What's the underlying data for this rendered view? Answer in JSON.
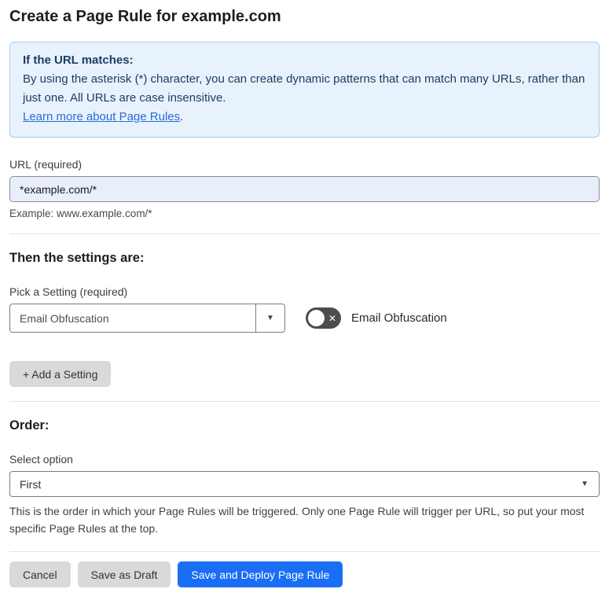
{
  "page": {
    "title": "Create a Page Rule for example.com"
  },
  "info_box": {
    "heading": "If the URL matches:",
    "body": "By using the asterisk (*) character, you can create dynamic patterns that can match many URLs, rather than just one. All URLs are case insensitive.",
    "link_label": "Learn more about Page Rules",
    "link_suffix": "."
  },
  "url_field": {
    "label": "URL (required)",
    "value": "*example.com/*",
    "helper": "Example: www.example.com/*"
  },
  "settings_section": {
    "heading": "Then the settings are:",
    "picker_label": "Pick a Setting (required)",
    "picker_value": "Email Obfuscation",
    "toggle_label": "Email Obfuscation",
    "toggle_state": "off",
    "toggle_off_glyph": "✕",
    "caret_glyph": "▼",
    "add_setting_label": "+ Add a Setting"
  },
  "order_section": {
    "heading": "Order:",
    "select_label": "Select option",
    "select_value": "First",
    "caret_glyph": "▼",
    "helper": "This is the order in which your Page Rules will be triggered. Only one Page Rule will trigger per URL, so put your most specific Page Rules at the top."
  },
  "footer": {
    "cancel_label": "Cancel",
    "save_draft_label": "Save as Draft",
    "save_deploy_label": "Save and Deploy Page Rule"
  },
  "colors": {
    "accent_blue": "#1a6ef5",
    "info_bg": "#e8f2fc",
    "info_border": "#aac8ea",
    "info_text": "#1e3c64",
    "link_blue": "#2b6cd4",
    "input_bg": "#e8eefc",
    "gray_btn": "#d9d9d9",
    "toggle_off": "#4d4d4d",
    "divider": "#e3e3e3"
  }
}
